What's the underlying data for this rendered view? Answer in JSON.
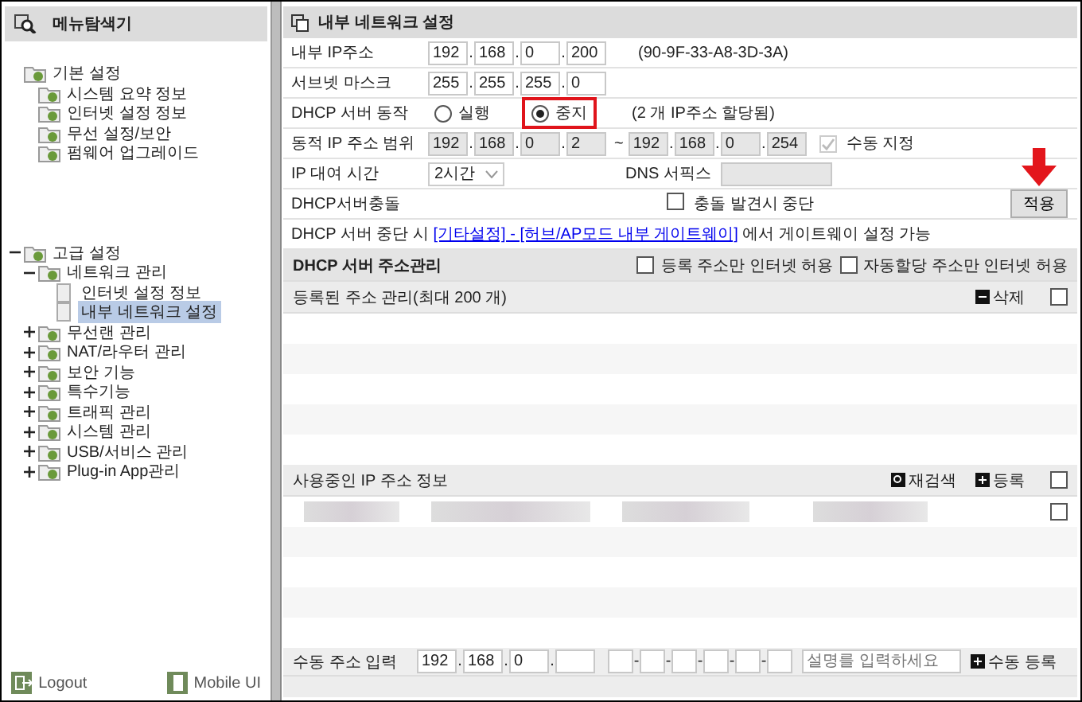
{
  "sidebar": {
    "title": "메뉴탐색기",
    "tree": [
      {
        "label": "기본 설정",
        "children": [
          {
            "label": "시스템 요약 정보"
          },
          {
            "label": "인터넷 설정 정보"
          },
          {
            "label": "무선 설정/보안"
          },
          {
            "label": "펌웨어 업그레이드"
          }
        ]
      },
      {
        "label": "고급 설정",
        "expanded": true,
        "children": [
          {
            "label": "네트워크 관리",
            "expanded": true,
            "children": [
              {
                "label": "인터넷 설정 정보",
                "selected": false
              },
              {
                "label": "내부 네트워크 설정",
                "selected": true
              }
            ]
          },
          {
            "label": "무선랜 관리",
            "expanded": false
          },
          {
            "label": "NAT/라우터 관리",
            "expanded": false
          },
          {
            "label": "보안 기능",
            "expanded": false
          },
          {
            "label": "특수기능",
            "expanded": false
          },
          {
            "label": "트래픽 관리",
            "expanded": false
          },
          {
            "label": "시스템 관리",
            "expanded": false
          },
          {
            "label": "USB/서비스 관리",
            "expanded": false
          },
          {
            "label": "Plug-in App관리",
            "expanded": false
          }
        ]
      }
    ],
    "footer": [
      {
        "kind": "logout",
        "label": "Logout"
      },
      {
        "kind": "mobile",
        "label": "Mobile UI"
      }
    ]
  },
  "panel": {
    "title": "내부 네트워크 설정",
    "ip_separator": ".",
    "internal_ip": {
      "label": "내부 IP주소",
      "octets": [
        "192",
        "168",
        "0",
        "200"
      ],
      "mac": "(90-9F-33-A8-3D-3A)"
    },
    "subnet": {
      "label": "서브넷 마스크",
      "octets": [
        "255",
        "255",
        "255",
        "0"
      ]
    },
    "dhcp_mode": {
      "label": "DHCP 서버 동작",
      "options": [
        {
          "label": "실행",
          "selected": false
        },
        {
          "label": "중지",
          "selected": true,
          "color": "#e0141b"
        }
      ],
      "note": "(2 개 IP주소 할당됨)"
    },
    "range": {
      "label": "동적 IP 주소 범위",
      "start": [
        "192",
        "168",
        "0",
        "2"
      ],
      "separator": "~",
      "end": [
        "192",
        "168",
        "0",
        "254"
      ],
      "disabled": true,
      "manual": {
        "label": "수동 지정",
        "checked": true,
        "disabled": true
      }
    },
    "lease": {
      "label": "IP 대여 시간",
      "value": "2시간",
      "dns_label": "DNS 서픽스"
    },
    "conflict": {
      "label": "DHCP서버충돌",
      "check": {
        "label": "충돌 발견시 중단",
        "checked": false
      },
      "apply": "적용",
      "arrow": true
    },
    "note": {
      "before": "DHCP 서버 중단 시 ",
      "link": "[기타설정] - [허브/AP모드 내부 게이트웨이]",
      "after": " 에서 게이트웨이 설정 가능"
    }
  },
  "address_mgmt": {
    "title": "DHCP 서버 주소관리",
    "options": [
      {
        "label": "등록 주소만 인터넷 허용",
        "checked": false
      },
      {
        "label": "자동할당 주소만 인터넷 허용",
        "checked": false
      }
    ],
    "registered": {
      "title": "등록된 주소 관리(최대 200 개)",
      "delete": "삭제",
      "checked": false
    },
    "in_use": {
      "title": "사용중인 IP 주소 정보",
      "rescan": "재검색",
      "register": "등록",
      "checked": false,
      "rows": [
        {
          "kind": "redacted",
          "checked": false
        }
      ]
    },
    "manual": {
      "label": "수동 주소 입력",
      "octets": [
        "192",
        "168",
        "0"
      ],
      "mac_separator": "-",
      "placeholder": "설명를 입력하세요",
      "button": "수동 등록"
    }
  }
}
